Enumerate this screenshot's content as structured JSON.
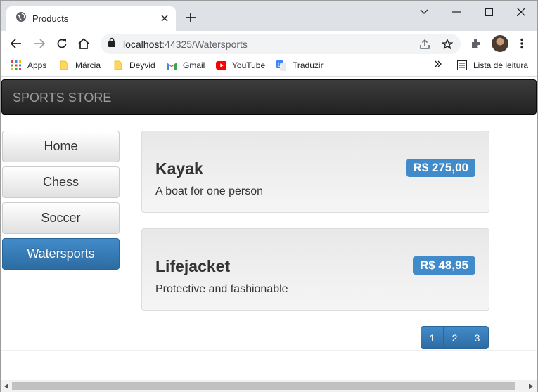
{
  "browser": {
    "tab_title": "Products",
    "address_host": "localhost",
    "address_rest": ":44325/Watersports",
    "bookmarks": [
      "Apps",
      "Márcia",
      "Deyvid",
      "Gmail",
      "YouTube",
      "Traduzir"
    ],
    "reading_list": "Lista de leitura"
  },
  "store": {
    "brand": "SPORTS STORE",
    "categories": [
      "Home",
      "Chess",
      "Soccer",
      "Watersports"
    ],
    "selected_category": "Watersports",
    "products": [
      {
        "name": "Kayak",
        "price": "R$ 275,00",
        "description": "A boat for one person"
      },
      {
        "name": "Lifejacket",
        "price": "R$ 48,95",
        "description": "Protective and fashionable"
      }
    ],
    "pages": [
      "1",
      "2",
      "3"
    ]
  },
  "colors": {
    "accent": "#428bca",
    "navbar": "#222222"
  }
}
